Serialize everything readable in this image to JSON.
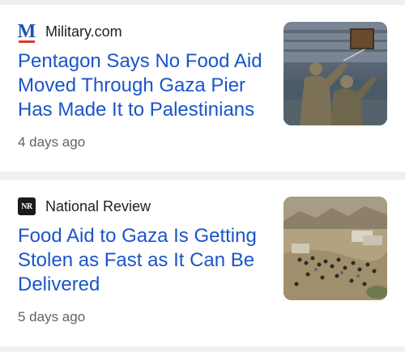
{
  "articles": [
    {
      "source": "Military.com",
      "source_logo": "M",
      "headline": "Pentagon Says No Food Aid Moved Through Gaza Pier Has Made It to Palestinians",
      "time": "4 days ago",
      "thumbnail": "soldiers-at-pier-image"
    },
    {
      "source": "National Review",
      "source_logo": "NR",
      "headline": "Food Aid to Gaza Is Getting Stolen as Fast as It Can Be Delivered",
      "time": "5 days ago",
      "thumbnail": "crowd-around-aid-trucks-image"
    }
  ],
  "colors": {
    "headline": "#1a55c9",
    "timestamp": "#5f6368",
    "background": "#eef0f2",
    "card": "#ffffff"
  }
}
